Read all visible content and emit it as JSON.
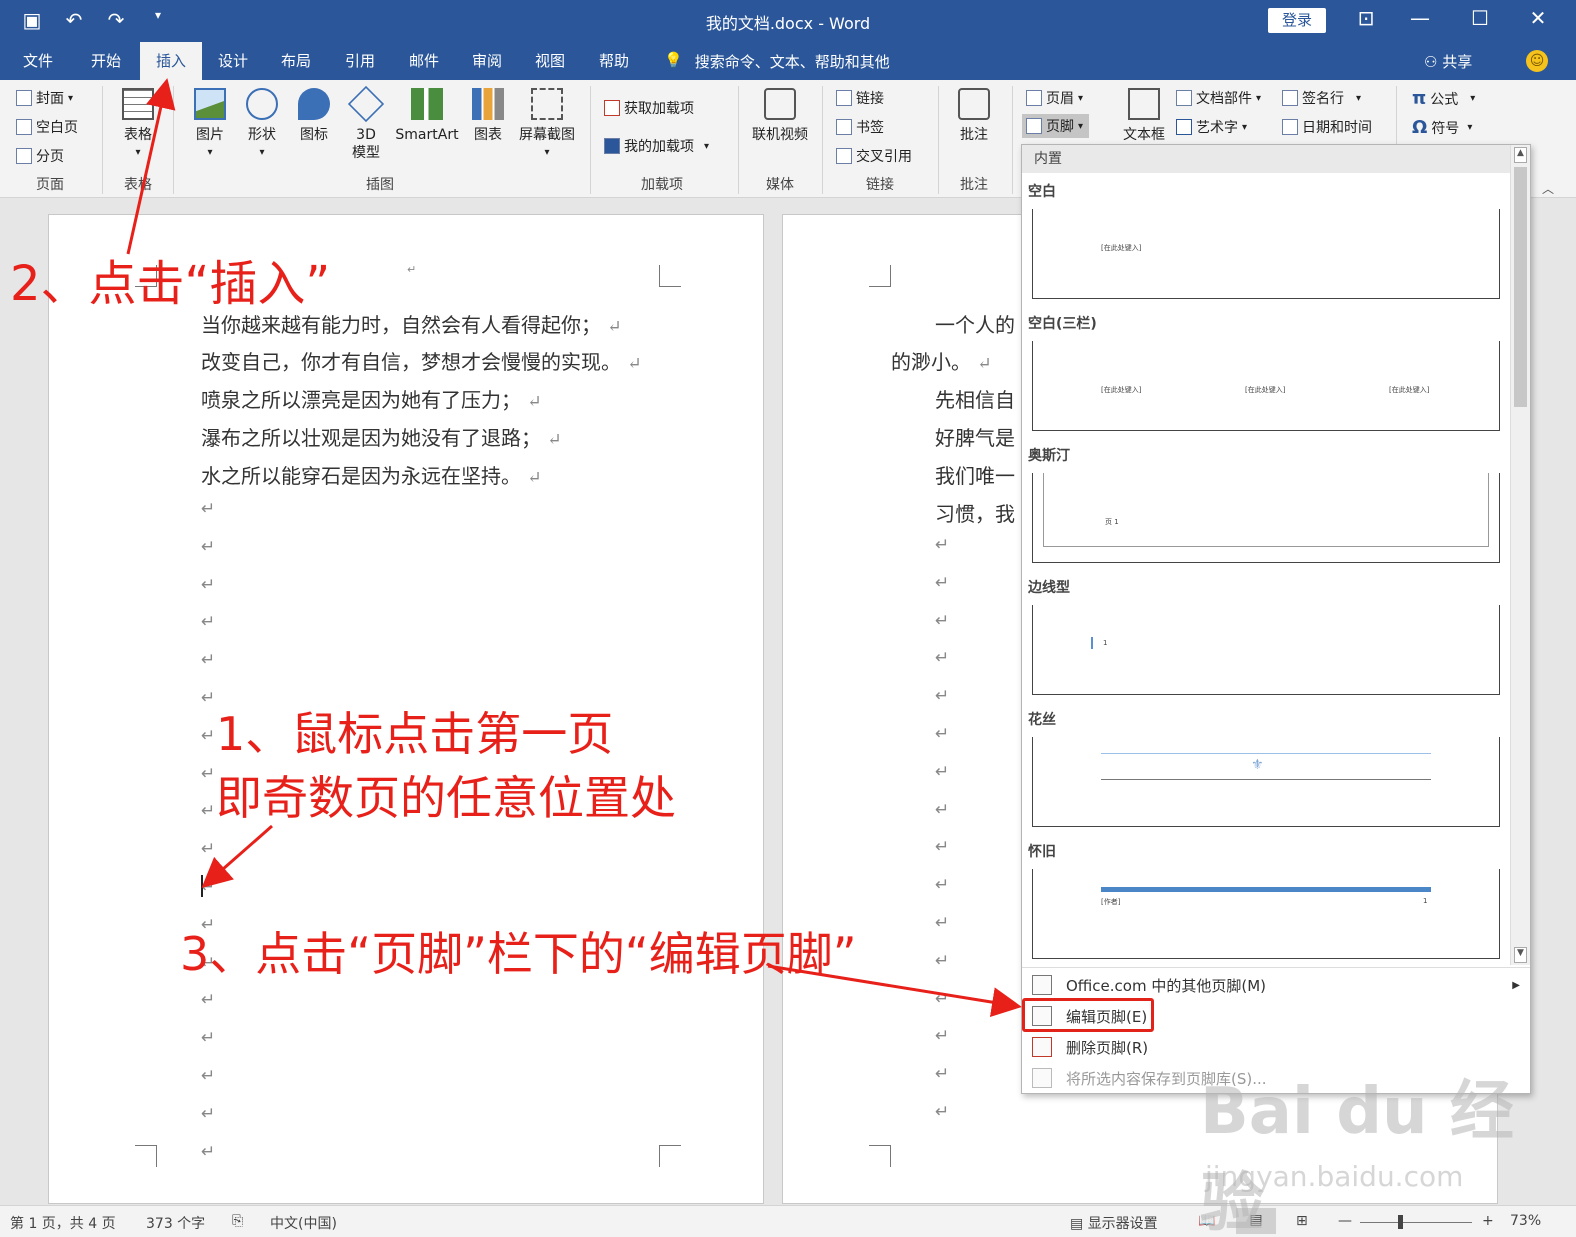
{
  "titlebar": {
    "title": "我的文档.docx  -  Word",
    "login": "登录",
    "qat": [
      "save-icon",
      "undo-icon",
      "redo-icon",
      "customize-icon"
    ]
  },
  "tabs": [
    "文件",
    "开始",
    "插入",
    "设计",
    "布局",
    "引用",
    "邮件",
    "审阅",
    "视图",
    "帮助"
  ],
  "active_tab": "插入",
  "tell_me": "搜索命令、文本、帮助和其他",
  "share": "共享",
  "ribbon": {
    "pages": {
      "cover": "封面",
      "blank": "空白页",
      "break": "分页",
      "label": "页面"
    },
    "table": {
      "btn": "表格",
      "label": "表格"
    },
    "illustrations": {
      "picture": "图片",
      "shapes": "形状",
      "icons": "图标",
      "model3d": "3D\n模型",
      "smartart": "SmartArt",
      "chart": "图表",
      "screenshot": "屏幕截图",
      "label": "插图"
    },
    "addins": {
      "get": "获取加载项",
      "mine": "我的加载项",
      "label": "加载项"
    },
    "media": {
      "video": "联机视频",
      "label": "媒体"
    },
    "links": {
      "link": "链接",
      "bookmark": "书签",
      "crossref": "交叉引用",
      "label": "链接"
    },
    "comments": {
      "comment": "批注",
      "label": "批注"
    },
    "headerfooter": {
      "header": "页眉",
      "footer": "页脚"
    },
    "text": {
      "textbox": "文本框",
      "quickparts": "文档部件",
      "wordart": "艺术字",
      "signature": "签名行",
      "datetime": "日期和时间"
    },
    "symbols": {
      "equation": "公式",
      "symbol": "符号"
    }
  },
  "page1": {
    "lines": [
      "当你越来越有能力时，自然会有人看得起你；",
      "改变自己，你才有自信，梦想才会慢慢的实现。",
      "喷泉之所以漂亮是因为她有了压力；",
      "瀑布之所以壮观是因为她没有了退路；",
      "水之所以能穿石是因为永远在坚持。"
    ]
  },
  "page2": {
    "lines": [
      "一个人的",
      "的渺小。",
      "先相信自",
      "好脾气是",
      "我们唯一",
      "习惯，我"
    ]
  },
  "footer_menu": {
    "header": "内置",
    "galleries": [
      {
        "name": "空白",
        "texts": [
          "[在此处键入]"
        ]
      },
      {
        "name": "空白(三栏)",
        "texts": [
          "[在此处键入]",
          "[在此处键入]",
          "[在此处键入]"
        ]
      },
      {
        "name": "奥斯汀",
        "texts": [
          "页 1"
        ]
      },
      {
        "name": "边线型",
        "texts": [
          "1"
        ]
      },
      {
        "name": "花丝",
        "texts": []
      },
      {
        "name": "怀旧",
        "texts": [
          "[作者]",
          "1"
        ]
      }
    ],
    "more": "Office.com 中的其他页脚(M)",
    "edit": "编辑页脚(E)",
    "remove": "删除页脚(R)",
    "save": "将所选内容保存到页脚库(S)..."
  },
  "annotations": {
    "step1_line1": "1、鼠标点击第一页",
    "step1_line2": "即奇数页的任意位置处",
    "step2": "2、点击“插入”",
    "step3": "3、点击“页脚”栏下的“编辑页脚”",
    "color": "#e8201a"
  },
  "statusbar": {
    "page": "第 1 页，共 4 页",
    "words": "373 个字",
    "lang": "中文(中国)",
    "display": "显示器设置",
    "zoom": "73%"
  },
  "watermark": {
    "main": "Bai du 经验",
    "sub": "jingyan.baidu.com"
  }
}
